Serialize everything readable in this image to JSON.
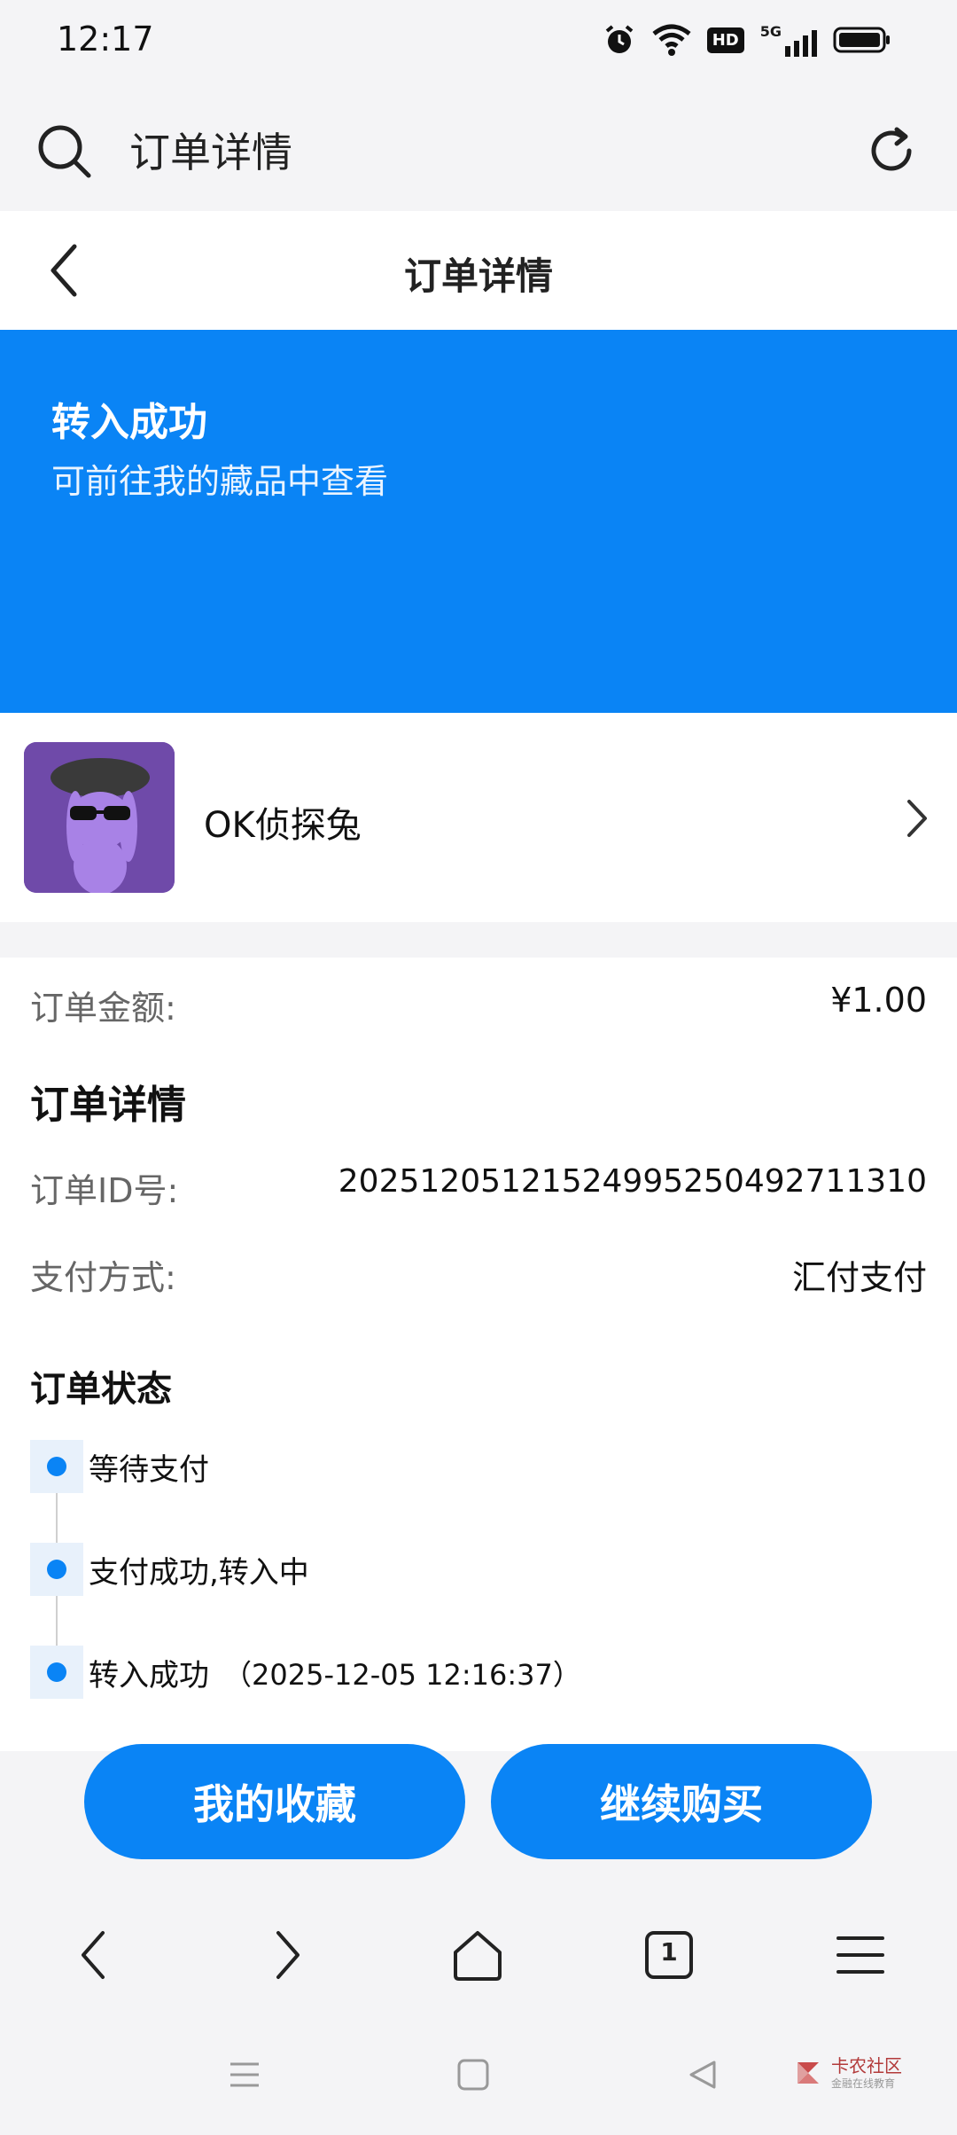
{
  "status_bar": {
    "time": "12:17",
    "icons": [
      "alarm-icon",
      "wifi-icon",
      "hd-icon",
      "signal-5g-icon",
      "battery-icon"
    ],
    "hd_label": "HD",
    "network_label": "5G"
  },
  "browser_bar": {
    "title": "订单详情",
    "search_icon": "search-icon",
    "refresh_icon": "refresh-icon"
  },
  "header": {
    "title": "订单详情",
    "back_icon": "chevron-left-icon"
  },
  "banner": {
    "title": "转入成功",
    "subtitle": "可前往我的藏品中查看",
    "color": "#0a84f5"
  },
  "product": {
    "name": "OK侦探兔",
    "thumb_color": "#7a52b8"
  },
  "order": {
    "amount_label": "订单金额:",
    "amount_value": "¥1.00",
    "details_title": "订单详情",
    "id_label": "订单ID号:",
    "id_value": "20251205121524995250492711310",
    "payment_label": "支付方式:",
    "payment_value": "汇付支付"
  },
  "status": {
    "title": "订单状态",
    "steps": [
      {
        "text": "等待支付"
      },
      {
        "text": "支付成功,转入中"
      },
      {
        "text": "转入成功",
        "time": "（2025-12-05 12:16:37）"
      }
    ]
  },
  "actions": {
    "collection_label": "我的收藏",
    "buy_label": "继续购买"
  },
  "browser_nav": {
    "tab_count": "1"
  },
  "watermark": {
    "brand": "卡农社区",
    "tagline": "金融在线教育"
  }
}
